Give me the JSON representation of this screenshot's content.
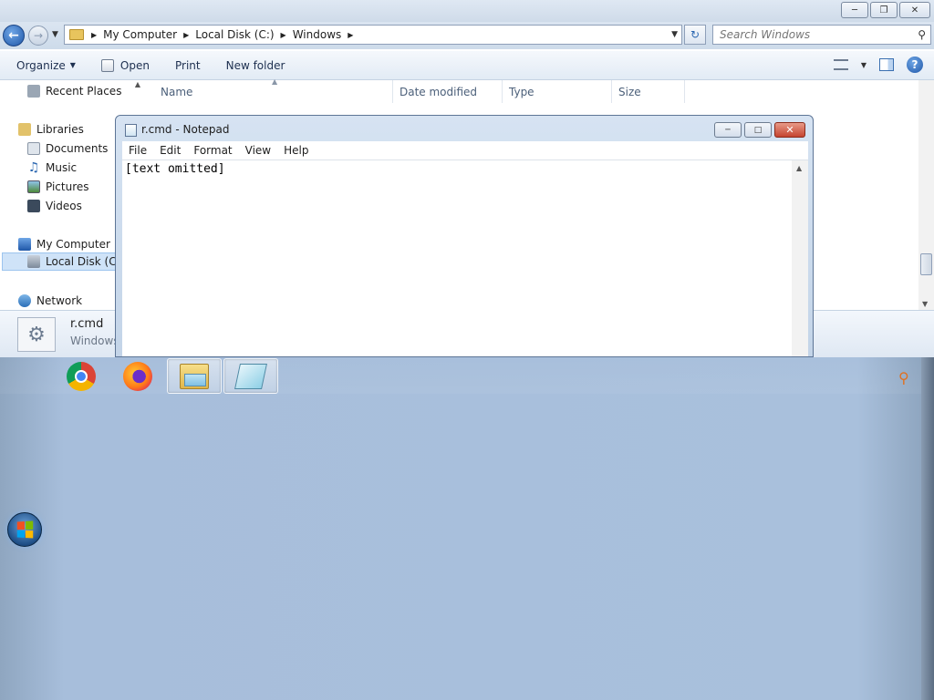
{
  "explorer": {
    "address": {
      "crumbs": [
        "My Computer",
        "Local Disk (C:)",
        "Windows"
      ]
    },
    "search": {
      "placeholder": "Search Windows"
    },
    "toolbar": {
      "organize": "Organize",
      "open": "Open",
      "print": "Print",
      "new_folder": "New folder"
    },
    "nav": {
      "recent_places": "Recent Places",
      "libraries": "Libraries",
      "documents": "Documents",
      "music": "Music",
      "pictures": "Pictures",
      "videos": "Videos",
      "my_computer": "My Computer",
      "local_disk": "Local Disk (C:)",
      "network": "Network"
    },
    "columns": {
      "name": "Name",
      "date_modified": "Date modified",
      "type": "Type",
      "size": "Size"
    },
    "details": {
      "file_name": "r.cmd",
      "file_type": "Windows"
    }
  },
  "notepad": {
    "title": "r.cmd - Notepad",
    "menu": {
      "file": "File",
      "edit": "Edit",
      "format": "Format",
      "view": "View",
      "help": "Help"
    },
    "content": "[text omitted]"
  },
  "taskbar": {
    "apps": [
      "chrome-icon",
      "firefox-icon",
      "windows-explorer-icon",
      "notepad-icon"
    ]
  }
}
